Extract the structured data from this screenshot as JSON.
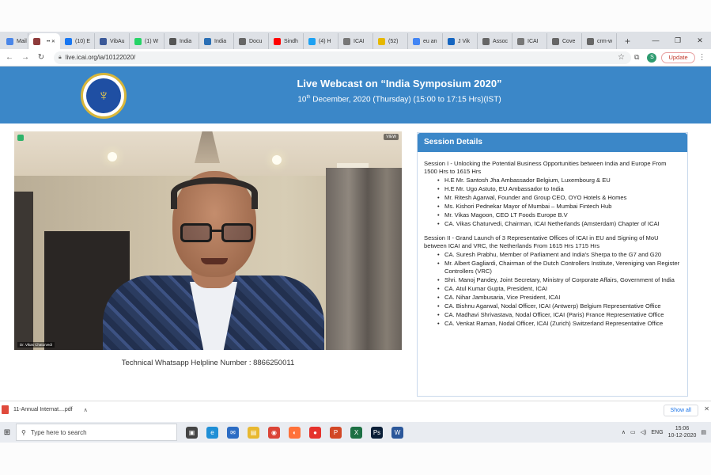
{
  "browser": {
    "tabs": [
      {
        "label": "Mail",
        "color": "#4a86e8"
      },
      {
        "label": "",
        "color": "#8e3b3b",
        "active": true
      },
      {
        "label": "(10) E",
        "color": "#1877f2"
      },
      {
        "label": "VibAu",
        "color": "#3b5998"
      },
      {
        "label": "(1) W",
        "color": "#25d366"
      },
      {
        "label": "India",
        "color": "#555555"
      },
      {
        "label": "India",
        "color": "#2a6fb5"
      },
      {
        "label": "Docu",
        "color": "#666666"
      },
      {
        "label": "Sindh",
        "color": "#ff0000"
      },
      {
        "label": "(4) H",
        "color": "#1da1f2"
      },
      {
        "label": "ICAI",
        "color": "#777777"
      },
      {
        "label": "(52)",
        "color": "#e6b800"
      },
      {
        "label": "eu an",
        "color": "#4285f4"
      },
      {
        "label": "J Vik",
        "color": "#1565c0"
      },
      {
        "label": "Assoc",
        "color": "#666666"
      },
      {
        "label": "ICAI",
        "color": "#777777"
      },
      {
        "label": "Cove",
        "color": "#666666"
      },
      {
        "label": "crm-w",
        "color": "#666666"
      }
    ],
    "new_tab": "+",
    "address": "live.icai.org/ia/10122020/",
    "profile_initial": "S",
    "update_label": "Update"
  },
  "header": {
    "title": "Live Webcast on “India Symposium 2020”",
    "date_prefix": "10",
    "date_sup": "th",
    "date_rest": " December, 2020 (Thursday) (15:00 to 17:15 Hrs)(IST)"
  },
  "helpline": "Technical Whatsapp Helpline Number : 8866250011",
  "video": {
    "participant_name": "Dr. Vikas Chaturvedi",
    "corner_label": "VIEW"
  },
  "session_panel": {
    "title": "Session Details",
    "sessions": [
      {
        "title": "Session I - Unlocking the Potential Business Opportunities between India and Europe From 1500 Hrs to 1615 Hrs",
        "items": [
          "H.E Mr. Santosh Jha Ambassador Belgium, Luxembourg & EU",
          "H.E Mr. Ugo Astuto, EU Ambassador to India",
          "Mr. Ritesh Agarwal, Founder and Group CEO, OYO Hotels & Homes",
          "Ms. Kishori Pednekar Mayor of Mumbai – Mumbai Fintech Hub",
          "Mr. Vikas Magoon, CEO LT Foods Europe B.V",
          "CA. Vikas Chaturvedi, Chairman, ICAI Netherlands (Amsterdam) Chapter of ICAI"
        ]
      },
      {
        "title": "Session II - Grand Launch of 3 Representative Offices of ICAI in EU and Signing of MoU between ICAI and VRC, the Netherlands From 1615 Hrs 1715 Hrs",
        "items": [
          "CA. Suresh Prabhu, Member of Parliament and India's Sherpa to the G7 and G20",
          "Mr. Albert Gagliardi, Chairman of the Dutch Controllers Institute, Vereniging van Register Controllers (VRC)",
          "Shri. Manoj Pandey, Joint Secretary, Ministry of Corporate Affairs, Government of India",
          "CA. Atul Kumar Gupta, President, ICAI",
          "CA. Nihar Jambusaria, Vice President, ICAI",
          "CA. Bishnu Agarwal, Nodal Officer, ICAI (Antwerp) Belgium Representative Office",
          "CA. Madhavi Shrivastava, Nodal Officer, ICAI (Paris) France Representative Office",
          "CA. Venkat Raman, Nodal Officer, ICAI (Zurich) Switzerland Representative Office"
        ]
      }
    ]
  },
  "download_bar": {
    "file_name": "11-Annual Internat....pdf",
    "show_all": "Show all",
    "close": "✕"
  },
  "taskbar": {
    "search_placeholder": "Type here to search",
    "apps": [
      {
        "name": "task-view",
        "color": "#444444",
        "glyph": "▣"
      },
      {
        "name": "edge",
        "color": "#1f8fd6",
        "glyph": "e"
      },
      {
        "name": "mail",
        "color": "#2b6cc4",
        "glyph": "✉"
      },
      {
        "name": "file-explorer",
        "color": "#e8b830",
        "glyph": "▤"
      },
      {
        "name": "chrome",
        "color": "#db4437",
        "glyph": "◉"
      },
      {
        "name": "firefox",
        "color": "#ff7139",
        "glyph": "◐"
      },
      {
        "name": "screen-recorder",
        "color": "#e5322d",
        "glyph": "●"
      },
      {
        "name": "powerpoint",
        "color": "#d24726",
        "glyph": "P"
      },
      {
        "name": "excel",
        "color": "#1d7044",
        "glyph": "X"
      },
      {
        "name": "photoshop",
        "color": "#0a1e37",
        "glyph": "Ps"
      },
      {
        "name": "word",
        "color": "#2b579a",
        "glyph": "W"
      }
    ],
    "language": "ENG",
    "time": "15:06",
    "date": "10-12-2020"
  }
}
